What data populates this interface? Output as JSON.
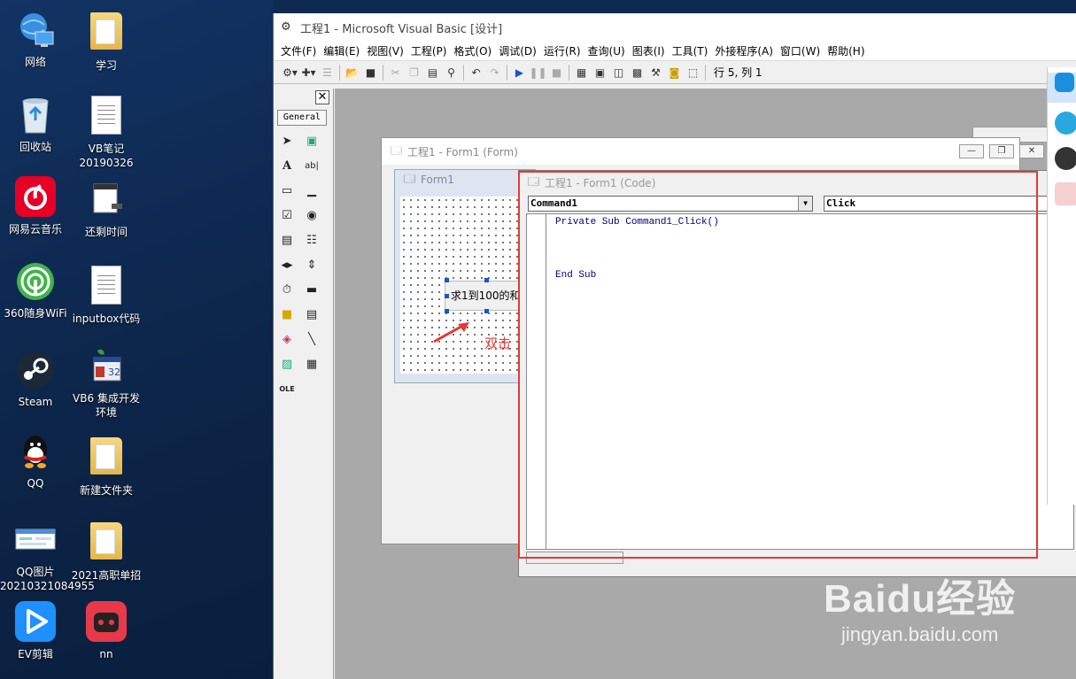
{
  "desktop": {
    "icons": [
      {
        "label": "网络",
        "icon": "network-icon"
      },
      {
        "label": "学习",
        "icon": "folder-icon"
      },
      {
        "label": "回收站",
        "icon": "recycle-bin-icon"
      },
      {
        "label": "VB笔记20190326",
        "icon": "document-icon"
      },
      {
        "label": "网易云音乐",
        "icon": "netease-music-icon"
      },
      {
        "label": "还剩时间",
        "icon": "clock-doc-icon"
      },
      {
        "label": "360随身WiFi",
        "icon": "wifi-icon"
      },
      {
        "label": "inputbox代码",
        "icon": "document-icon"
      },
      {
        "label": "Steam",
        "icon": "steam-icon"
      },
      {
        "label": "VB6 集成开发环境",
        "icon": "vb6-icon"
      },
      {
        "label": "QQ",
        "icon": "qq-icon"
      },
      {
        "label": "新建文件夹",
        "icon": "folder-icon"
      },
      {
        "label": "QQ图片20210321084955",
        "icon": "image-icon"
      },
      {
        "label": "2021高职单招",
        "icon": "folder-icon"
      },
      {
        "label": "EV剪辑",
        "icon": "play-icon"
      },
      {
        "label": "nn",
        "icon": "nn-icon"
      }
    ]
  },
  "ide": {
    "title": "工程1 - Microsoft Visual Basic [设计]",
    "menu": [
      "文件(F)",
      "编辑(E)",
      "视图(V)",
      "工程(P)",
      "格式(O)",
      "调试(D)",
      "运行(R)",
      "查询(U)",
      "图表(I)",
      "工具(T)",
      "外接程序(A)",
      "窗口(W)",
      "帮助(H)"
    ],
    "status_rowcol": "行 5, 列 1",
    "toolbox_header": "General"
  },
  "form_window": {
    "title": "工程1 - Form1 (Form)",
    "designer_title": "Form1",
    "button_caption": "求1到100的和"
  },
  "code_window": {
    "title": "工程1 - Form1 (Code)",
    "object_combo": "Command1",
    "proc_combo": "Click",
    "lines": [
      "Private Sub Command1_Click()",
      "",
      "",
      "",
      "End Sub"
    ]
  },
  "annotation": {
    "text": "双击",
    "color": "#e53935"
  },
  "watermark": {
    "brand": "Baidu经验",
    "url": "jingyan.baidu.com"
  }
}
